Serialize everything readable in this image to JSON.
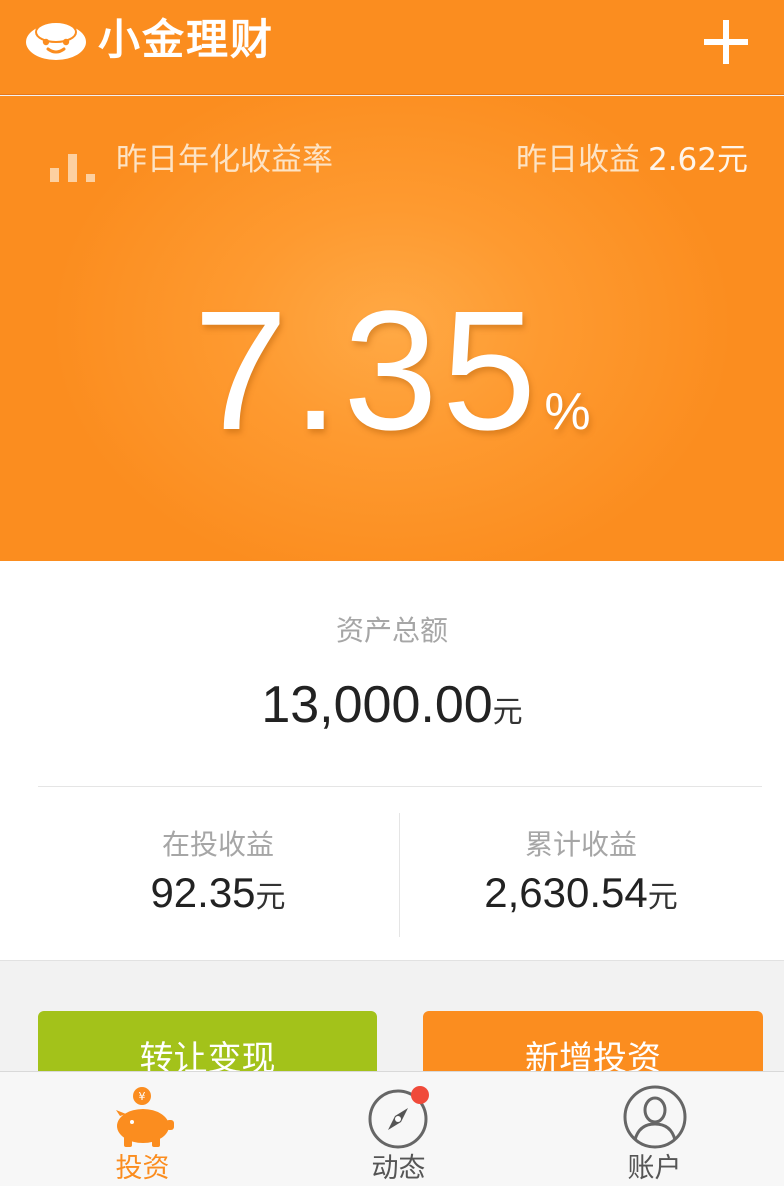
{
  "header": {
    "brand": "小金理财",
    "add_icon": "plus-icon",
    "logo_icon": "ingot-logo-icon"
  },
  "hero": {
    "rate_label": "昨日年化收益率",
    "yesterday_label": "昨日收益",
    "yesterday_amount": "2.62元",
    "rate_value": "7.35",
    "rate_unit": "%"
  },
  "assets": {
    "total_label": "资产总额",
    "total_value": "13,000.00",
    "unit": "元",
    "holding_label": "在投收益",
    "holding_value": "92.35",
    "cumulative_label": "累计收益",
    "cumulative_value": "2,630.54"
  },
  "actions": {
    "transfer_label": "转让变现",
    "invest_label": "新增投资"
  },
  "tabs": [
    {
      "label": "投资",
      "icon": "piggy-bank-icon",
      "active": true
    },
    {
      "label": "动态",
      "icon": "compass-icon",
      "badge": true
    },
    {
      "label": "账户",
      "icon": "user-icon"
    }
  ],
  "colors": {
    "brand_orange": "#fb8d1f",
    "green": "#a3c21a",
    "badge_red": "#f04a3a"
  }
}
